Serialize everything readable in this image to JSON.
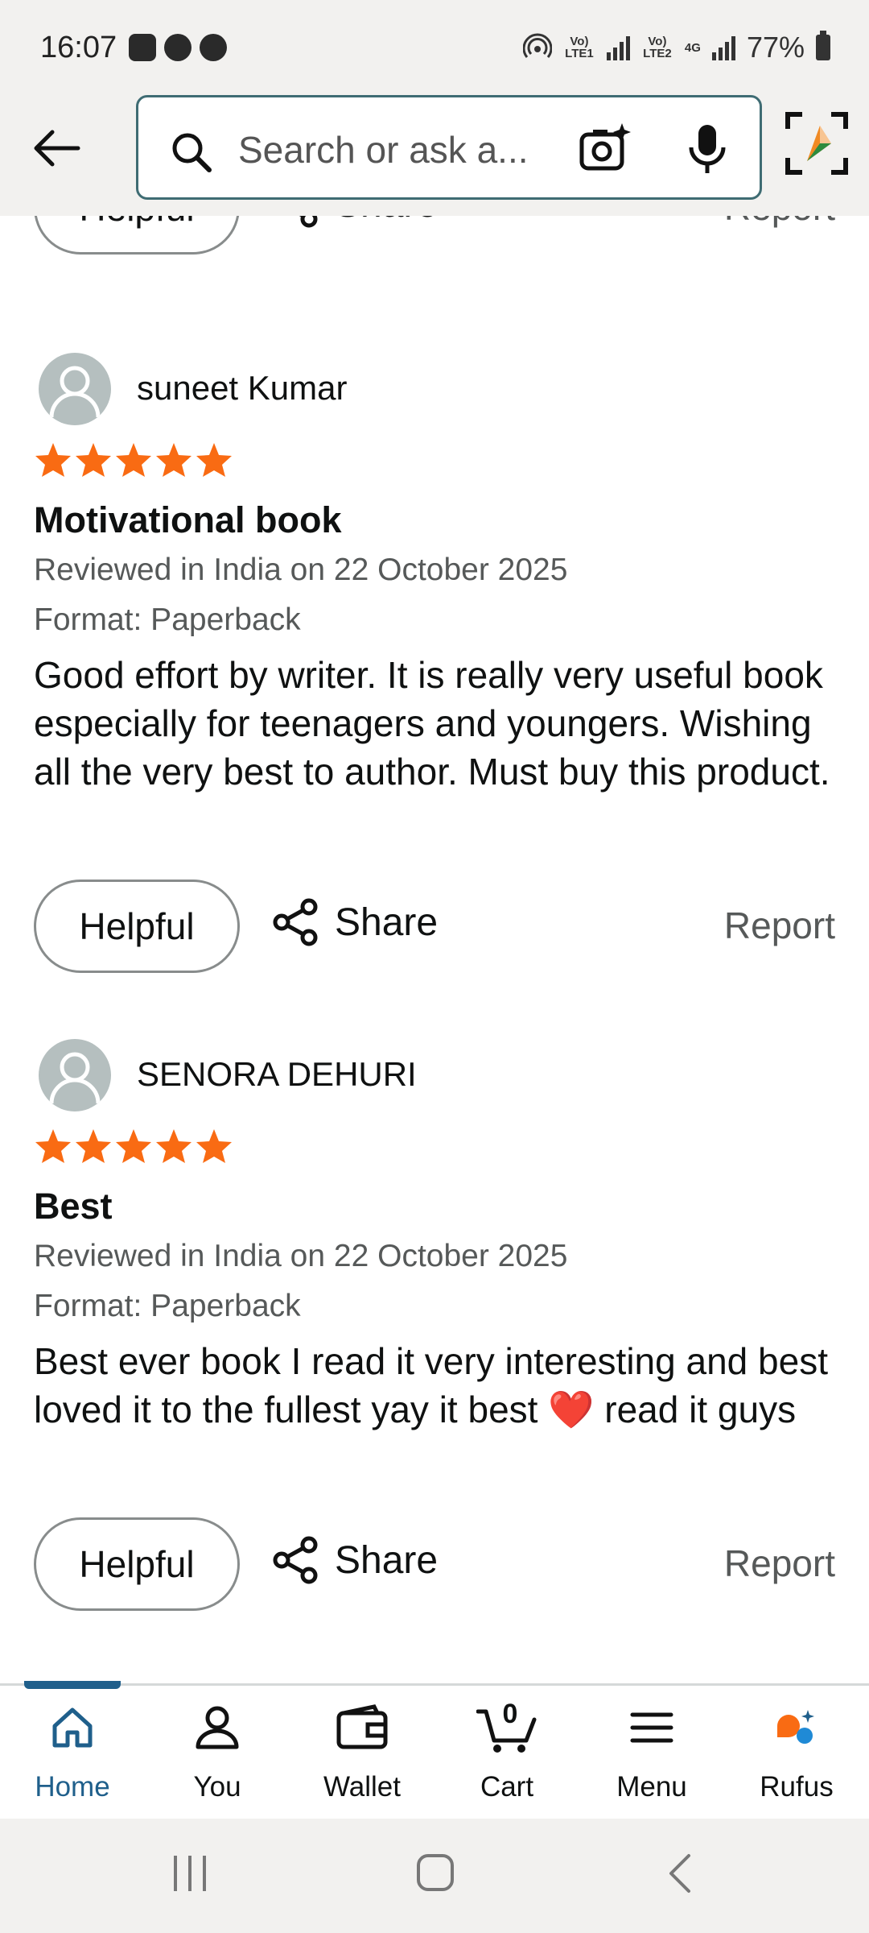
{
  "status_bar": {
    "time": "16:07",
    "sim1_label": "Vo) LTE1",
    "sim2_label": "Vo) LTE2",
    "network": "4G",
    "battery": "77%"
  },
  "header": {
    "search_placeholder": "Search or ask a..."
  },
  "top_actions": {
    "helpful": "Helpful",
    "share": "Share",
    "report": "Report"
  },
  "reviews": [
    {
      "reviewer": "suneet Kumar",
      "rating": 5,
      "title": "Motivational book",
      "date": "Reviewed in India on 22 October 2025",
      "format": "Format: Paperback",
      "body": "Good effort by writer. It is really very useful book especially for teenagers and youngers. Wishing all the very best to author. Must buy this product.",
      "helpful": "Helpful",
      "share": "Share",
      "report": "Report"
    },
    {
      "reviewer": "SENORA DEHURI",
      "rating": 5,
      "title": "Best",
      "date": "Reviewed in India on 22 October 2025",
      "format": "Format: Paperback",
      "body": "Best ever book I read it very interesting and best loved it to the fullest yay it best ❤️ read it guys",
      "helpful": "Helpful",
      "share": "Share",
      "report": "Report"
    }
  ],
  "bottom_nav": {
    "items": [
      {
        "label": "Home",
        "icon": "home-icon",
        "active": true
      },
      {
        "label": "You",
        "icon": "person-icon"
      },
      {
        "label": "Wallet",
        "icon": "wallet-icon"
      },
      {
        "label": "Cart",
        "icon": "cart-icon",
        "badge": "0"
      },
      {
        "label": "Menu",
        "icon": "menu-icon"
      },
      {
        "label": "Rufus",
        "icon": "rufus-icon"
      }
    ]
  },
  "colors": {
    "accent": "#1f5f8b",
    "star": "#f96b13",
    "search_border": "#3f6c73"
  }
}
